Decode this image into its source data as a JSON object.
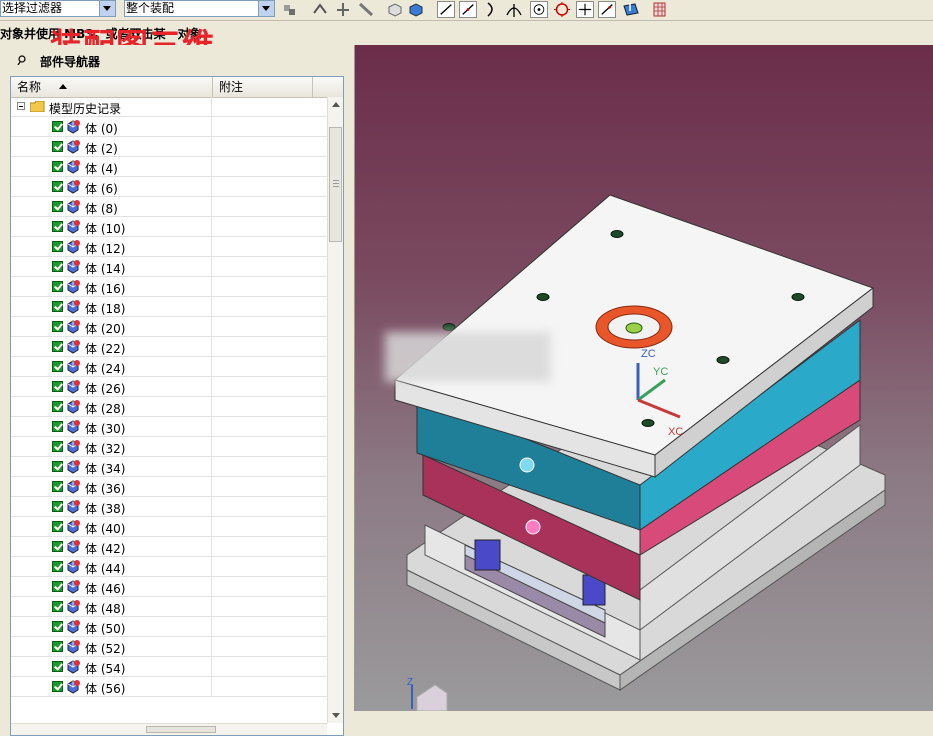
{
  "toolbar": {
    "filter_combo": "选择过滤器",
    "scope_combo": "整个装配"
  },
  "status": {
    "prompt": "对象并使用 MB3，或者双击某一对象"
  },
  "overlay": {
    "title": "装配图三维"
  },
  "navigator": {
    "title": "部件导航器",
    "col_name": "名称",
    "col_note": "附注",
    "root_label": "模型历史记录",
    "bodies": [
      "体 (0)",
      "体 (2)",
      "体 (4)",
      "体 (6)",
      "体 (8)",
      "体 (10)",
      "体 (12)",
      "体 (14)",
      "体 (16)",
      "体 (18)",
      "体 (20)",
      "体 (22)",
      "体 (24)",
      "体 (26)",
      "体 (28)",
      "体 (30)",
      "体 (32)",
      "体 (34)",
      "体 (36)",
      "体 (38)",
      "体 (40)",
      "体 (42)",
      "体 (44)",
      "体 (46)",
      "体 (48)",
      "体 (50)",
      "体 (52)",
      "体 (54)",
      "体 (56)"
    ]
  },
  "viewport": {
    "axis_labels": {
      "zc": "ZC",
      "yc": "YC",
      "xc": "XC"
    },
    "triad_label": "Z"
  },
  "colors": {
    "top_plate": "#f5f5f5",
    "cavity_plate": "#2aa9c9",
    "core_plate": "#d84a7a",
    "locating_ring": "#e8562a",
    "background_top": "#6b2d4a"
  }
}
